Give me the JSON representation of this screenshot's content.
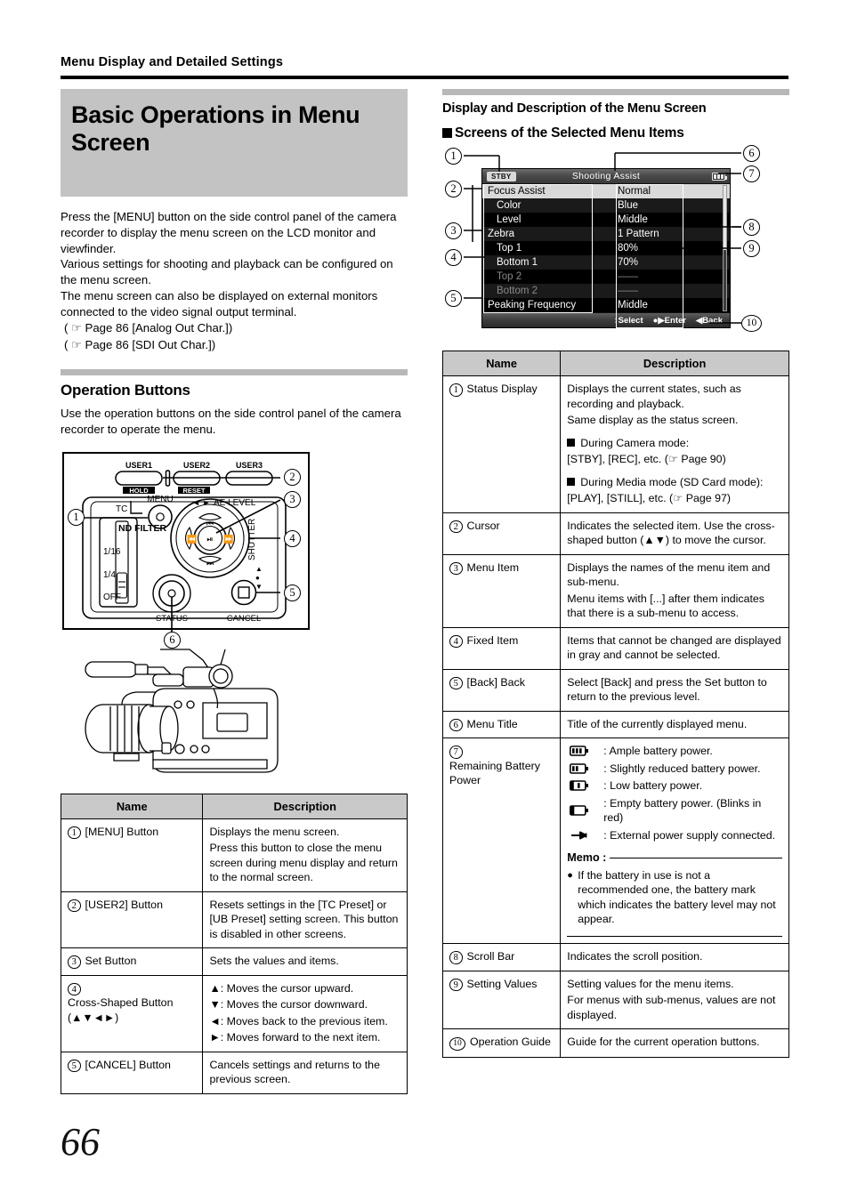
{
  "running_head": "Menu Display and Detailed Settings",
  "chapter_title": "Basic Operations in Menu Screen",
  "page_number": "66",
  "left": {
    "intro": [
      "Press the [MENU] button on the side control panel of the camera recorder to display the menu screen on the LCD monitor and viewfinder.",
      "Various settings for shooting and playback can be configured on the menu screen.",
      "The menu screen can also be displayed on external monitors connected to the video signal output terminal."
    ],
    "refs": [
      "( ☞ Page 86 [Analog Out Char.])",
      "( ☞ Page 86 [SDI Out Char.])"
    ],
    "section_title": "Operation Buttons",
    "section_intro": "Use the operation buttons on the side control panel of the camera recorder to operate the menu.",
    "panel_labels": {
      "user1": "USER1",
      "user2": "USER2",
      "user3": "USER3",
      "hold": "HOLD",
      "reset": "RESET",
      "tc": "TC",
      "menu": "MENU",
      "ae_level": "AE LEVEL",
      "shutter": "SHUTTER",
      "nd_filter": "ND FILTER",
      "nd_1_16": "1/16",
      "nd_1_4": "1/4",
      "nd_off": "OFF",
      "status": "STATUS",
      "cancel": "CANCEL"
    },
    "panel_callouts": [
      "1",
      "2",
      "3",
      "4",
      "5",
      "6"
    ],
    "table": {
      "headers": [
        "Name",
        "Description"
      ],
      "rows": [
        {
          "num": "1",
          "name": "[MENU] Button",
          "desc": [
            "Displays the menu screen.",
            "Press this button to close the menu screen during menu display and return to the normal screen."
          ]
        },
        {
          "num": "2",
          "name": "[USER2] Button",
          "desc": [
            "Resets settings in the [TC Preset] or [UB Preset] setting screen. This button is disabled in other screens."
          ]
        },
        {
          "num": "3",
          "name": "Set Button",
          "desc": [
            "Sets the values and items."
          ]
        },
        {
          "num": "4",
          "name": "Cross-Shaped Button (▲▼◄►)",
          "desc": [
            "▲: Moves the cursor upward.",
            "▼: Moves the cursor downward.",
            "◄: Moves back to the previous item.",
            "►: Moves forward to the next item."
          ]
        },
        {
          "num": "5",
          "name": "[CANCEL] Button",
          "desc": [
            "Cancels settings and returns to the previous screen."
          ]
        }
      ]
    }
  },
  "right": {
    "section_title": "Display and Description of the Menu Screen",
    "subsection_title": "Screens of the Selected Menu Items",
    "menu_screen": {
      "status_badge": "STBY",
      "title": "Shooting Assist",
      "battery_icon": "battery-full-icon",
      "rows": [
        {
          "label": "Focus Assist",
          "value": "Normal",
          "indent": false,
          "fixed": false,
          "cursor": true
        },
        {
          "label": "Color",
          "value": "Blue",
          "indent": true,
          "fixed": false,
          "cursor": false
        },
        {
          "label": "Level",
          "value": "Middle",
          "indent": true,
          "fixed": false,
          "cursor": false
        },
        {
          "label": "Zebra",
          "value": "1 Pattern",
          "indent": false,
          "fixed": false,
          "cursor": false
        },
        {
          "label": "Top 1",
          "value": "80%",
          "indent": true,
          "fixed": false,
          "cursor": false
        },
        {
          "label": "Bottom 1",
          "value": "70%",
          "indent": true,
          "fixed": false,
          "cursor": false
        },
        {
          "label": "Top 2",
          "value": "——",
          "indent": true,
          "fixed": true,
          "cursor": false
        },
        {
          "label": "Bottom 2",
          "value": "——",
          "indent": true,
          "fixed": true,
          "cursor": false
        },
        {
          "label": "Peaking Frequency",
          "value": "Middle",
          "indent": false,
          "fixed": false,
          "cursor": false
        }
      ],
      "back_label": "Back",
      "guide": [
        "↕Select",
        "●▶Enter",
        "◀Back"
      ]
    },
    "menu_callouts": [
      "1",
      "2",
      "3",
      "4",
      "5",
      "6",
      "7",
      "8",
      "9",
      "10"
    ],
    "table": {
      "headers": [
        "Name",
        "Description"
      ],
      "rows": [
        {
          "num": "1",
          "name": "Status Display",
          "desc": [
            "Displays the current states, such as recording and playback.",
            "Same display as the status screen."
          ],
          "blocks": [
            {
              "square": true,
              "text": "During Camera mode:"
            },
            {
              "square": false,
              "text": "[STBY], [REC], etc. (☞ Page 90)"
            },
            {
              "square": true,
              "text": "During Media mode (SD Card mode):"
            },
            {
              "square": false,
              "text": "[PLAY], [STILL], etc. (☞ Page 97)"
            }
          ]
        },
        {
          "num": "2",
          "name": "Cursor",
          "desc": [
            "Indicates the selected item. Use the cross-shaped button (▲▼) to move the cursor."
          ]
        },
        {
          "num": "3",
          "name": "Menu Item",
          "desc": [
            "Displays the names of the menu item and sub-menu.",
            "Menu items with [...] after them indicates that there is a sub-menu to access."
          ]
        },
        {
          "num": "4",
          "name": "Fixed Item",
          "desc": [
            "Items that cannot be changed are displayed in gray and cannot be selected."
          ]
        },
        {
          "num": "5",
          "name": "[Back] Back",
          "desc": [
            "Select [Back] and press the Set button to return to the previous level."
          ]
        },
        {
          "num": "6",
          "name": "Menu Title",
          "desc": [
            "Title of the currently displayed menu."
          ]
        },
        {
          "num": "7",
          "name": "Remaining Battery Power",
          "battery": [
            {
              "icon": "battery-full-icon",
              "text": ": Ample battery power."
            },
            {
              "icon": "battery-two-thirds-icon",
              "text": ": Slightly reduced battery power."
            },
            {
              "icon": "battery-low-icon",
              "text": ": Low battery power."
            },
            {
              "icon": "battery-empty-icon",
              "text": ": Empty battery power. (Blinks in red)"
            },
            {
              "icon": "power-plug-icon",
              "text": ": External power supply connected."
            }
          ],
          "memo_label": "Memo :",
          "memo_text": "If the battery in use is not a recommended one, the battery mark which indicates the battery level may not appear."
        },
        {
          "num": "8",
          "name": "Scroll Bar",
          "desc": [
            "Indicates the scroll position."
          ]
        },
        {
          "num": "9",
          "name": "Setting Values",
          "desc": [
            "Setting values for the menu items.",
            "For menus with sub-menus, values are not displayed."
          ]
        },
        {
          "num": "10",
          "name": "Operation Guide",
          "desc": [
            "Guide for the current operation buttons."
          ]
        }
      ]
    }
  }
}
